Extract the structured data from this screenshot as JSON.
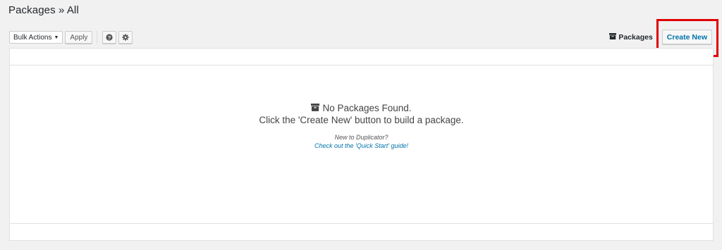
{
  "header": {
    "title": "Packages » All"
  },
  "toolbar": {
    "bulk_actions": {
      "selected": "Bulk Actions"
    },
    "apply_label": "Apply",
    "help_icon": "question-circle-icon",
    "settings_icon": "gear-icon"
  },
  "right": {
    "packages_label": "Packages",
    "packages_icon": "archive-icon",
    "create_new_label": "Create New",
    "highlight_color": "#e00000"
  },
  "empty_state": {
    "icon": "archive-icon",
    "title": "No Packages Found.",
    "subtitle": "Click the 'Create New' button to build a package.",
    "new_text": "New to Duplicator?",
    "guide_link": "Check out the 'Quick Start' guide!"
  },
  "colors": {
    "link": "#0073aa",
    "background": "#f1f1f1"
  }
}
